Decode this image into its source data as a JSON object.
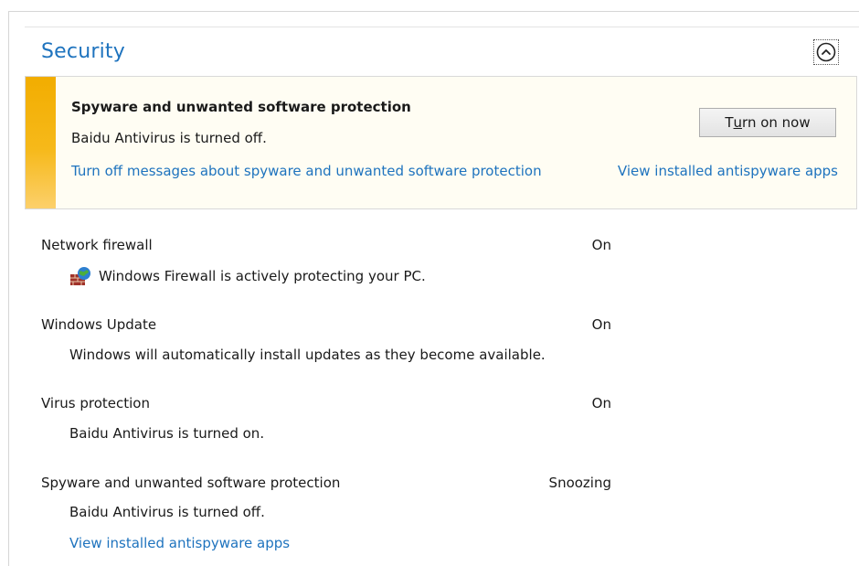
{
  "security": {
    "title": "Security",
    "collapse_icon": "chevron-up-icon"
  },
  "alert": {
    "accent_color": "#f2ad00",
    "heading": "Spyware and unwanted software protection",
    "status": "Baidu Antivirus is turned off.",
    "link_turn_off": "Turn off messages about spyware and unwanted software protection",
    "link_view": "View installed antispyware apps",
    "button_label_prefix": "T",
    "button_label_underlined": "u",
    "button_label_suffix": "rn on now"
  },
  "rows": [
    {
      "label": "Network firewall",
      "value": "On",
      "description": "Windows Firewall is actively protecting your PC.",
      "icon": "firewall-icon"
    },
    {
      "label": "Windows Update",
      "value": "On",
      "description": "Windows will automatically install updates as they become available."
    },
    {
      "label": "Virus protection",
      "value": "On",
      "description": "Baidu Antivirus is turned on."
    },
    {
      "label": "Spyware and unwanted software protection",
      "value": "Snoozing",
      "description": "Baidu Antivirus is turned off.",
      "link": "View installed antispyware apps"
    }
  ],
  "colors": {
    "link": "#1e73be",
    "title": "#1e73be"
  }
}
